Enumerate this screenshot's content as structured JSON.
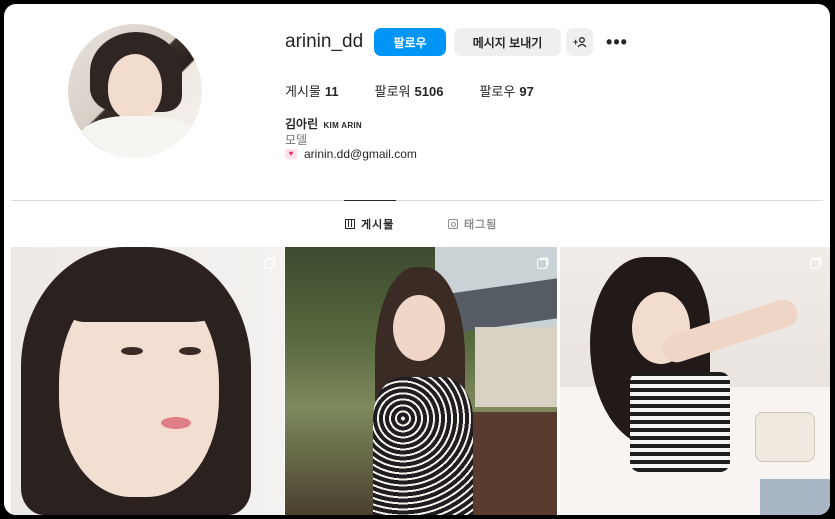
{
  "profile": {
    "username": "arinin_dd",
    "full_name": "김아린",
    "full_name_en": "KIM ARIN",
    "category": "모델",
    "email": "arinin.dd@gmail.com"
  },
  "actions": {
    "follow_label": "팔로우",
    "message_label": "메시지 보내기",
    "add_user_icon": "add-person-icon",
    "more_label": "•••"
  },
  "stats": {
    "posts_label": "게시물",
    "posts_count": "11",
    "followers_label": "팔로워",
    "followers_count": "5106",
    "following_label": "팔로우",
    "following_count": "97"
  },
  "tabs": [
    {
      "label": "게시물",
      "icon": "grid-icon",
      "active": true
    },
    {
      "label": "태그됨",
      "icon": "tag-icon",
      "active": false
    }
  ],
  "posts": [
    {
      "icon": "multi-photo-icon"
    },
    {
      "icon": "multi-photo-icon"
    },
    {
      "icon": "multi-photo-icon"
    }
  ],
  "colors": {
    "accent": "#0095f6",
    "secondary_button": "#efefef",
    "text": "#262626",
    "muted": "#737373"
  }
}
